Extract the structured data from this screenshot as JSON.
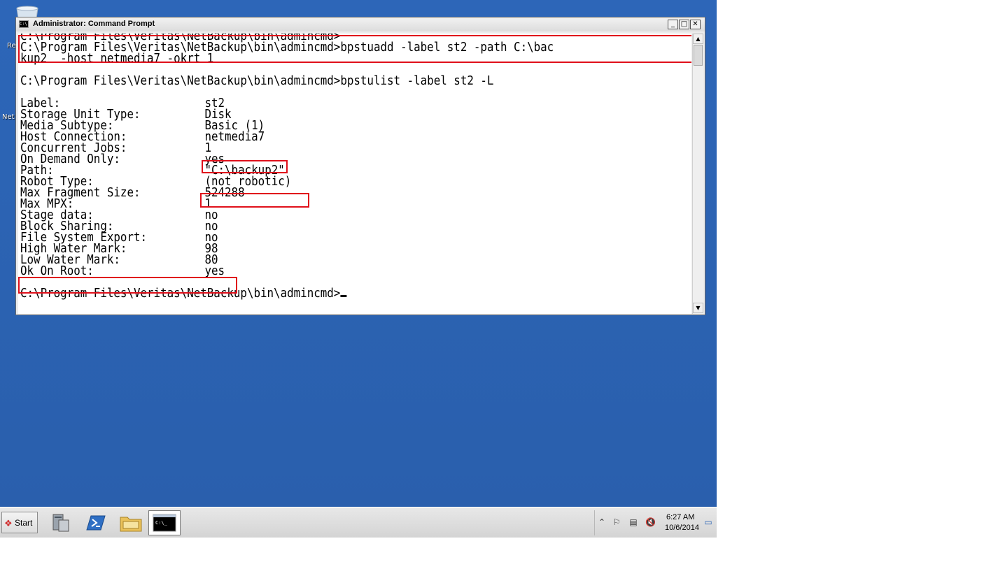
{
  "desktop": {
    "icon_labels": [
      "Re",
      "Net"
    ]
  },
  "window": {
    "title": "Administrator: Command Prompt",
    "icon_text": "C:\\",
    "buttons": {
      "minimize": "_",
      "maximize": "□",
      "close": "✕"
    }
  },
  "console": {
    "line_prev_prompt": "C:\\Program Files\\Veritas\\NetBackup\\bin\\admincmd>",
    "cmd1_line1": "C:\\Program Files\\Veritas\\NetBackup\\bin\\admincmd>bpstuadd -label st2 -path C:\\bac",
    "cmd1_line2": "kup2  -host netmedia7 -okrt 1",
    "cmd2": "C:\\Program Files\\Veritas\\NetBackup\\bin\\admincmd>bpstulist -label st2 -L",
    "fields": [
      {
        "label": "Label:",
        "value": "st2"
      },
      {
        "label": "Storage Unit Type:",
        "value": "Disk"
      },
      {
        "label": "Media Subtype:",
        "value": "Basic (1)"
      },
      {
        "label": "Host Connection:",
        "value": "netmedia7"
      },
      {
        "label": "Concurrent Jobs:",
        "value": "1"
      },
      {
        "label": "On Demand Only:",
        "value": "yes"
      },
      {
        "label": "Path:",
        "value": "\"C:\\backup2\""
      },
      {
        "label": "Robot Type:",
        "value": "(not robotic)"
      },
      {
        "label": "Max Fragment Size:",
        "value": "524288"
      },
      {
        "label": "Max MPX:",
        "value": "1"
      },
      {
        "label": "Stage data:",
        "value": "no"
      },
      {
        "label": "Block Sharing:",
        "value": "no"
      },
      {
        "label": "File System Export:",
        "value": "no"
      },
      {
        "label": "High Water Mark:",
        "value": "98"
      },
      {
        "label": "Low Water Mark:",
        "value": "80"
      },
      {
        "label": "Ok On Root:",
        "value": "yes"
      }
    ],
    "final_prompt": "C:\\Program Files\\Veritas\\NetBackup\\bin\\admincmd>"
  },
  "scrollbar": {
    "up": "▲",
    "down": "▼"
  },
  "taskbar": {
    "start_label": "Start",
    "start_flag": "❖",
    "clock_time": "6:27 AM",
    "clock_date": "10/6/2014",
    "tray_icons": [
      "chevron-up-icon",
      "flag-icon",
      "network-icon",
      "speaker-muted-icon",
      "show-desktop-icon"
    ],
    "tray_glyphs": [
      "⌃",
      "⚐",
      "▤",
      "🔇",
      "▭"
    ]
  },
  "colors": {
    "desktop": "#2b64b5",
    "highlight": "#e0101b",
    "console_bg": "#ffffff",
    "console_fg": "#000000"
  }
}
